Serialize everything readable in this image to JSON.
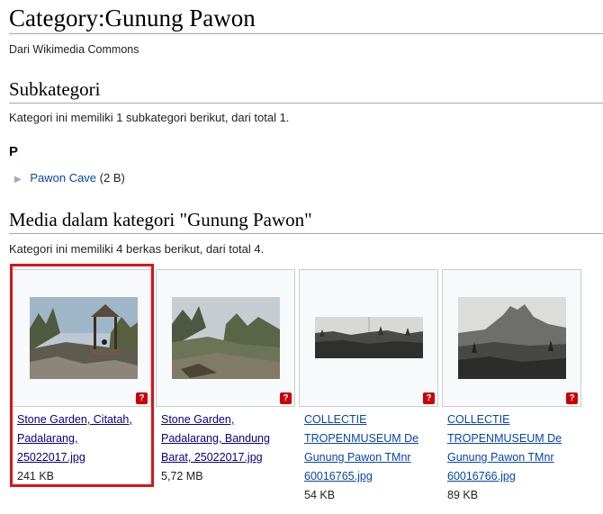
{
  "page": {
    "title": "Category:Gunung Pawon",
    "tagline": "Dari Wikimedia Commons"
  },
  "subcategories": {
    "heading": "Subkategori",
    "summary": "Kategori ini memiliki 1 subkategori berikut, dari total 1.",
    "letter": "P",
    "items": [
      {
        "bullet": "▶",
        "label": "Pawon Cave",
        "count": "(2 B)"
      }
    ]
  },
  "media": {
    "heading": "Media dalam kategori \"Gunung Pawon\"",
    "summary": "Kategori ini memiliki 4 berkas berikut, dari total 4.",
    "badge": "?",
    "files": [
      {
        "name_lines": [
          "Stone Garden, Citatah,",
          "Padalarang,",
          "25022017.jpg"
        ],
        "size": "241 KB",
        "color": "#0b0080"
      },
      {
        "name_lines": [
          "Stone Garden,",
          "Padalarang, Bandung",
          "Barat, 25022017.jpg"
        ],
        "size": "5,72 MB",
        "color": "#0b0080"
      },
      {
        "name_lines": [
          "COLLECTIE",
          "TROPENMUSEUM De",
          "Gunung Pawon TMnr",
          "60016765.jpg"
        ],
        "size": "54 KB",
        "color": "#0645ad"
      },
      {
        "name_lines": [
          "COLLECTIE",
          "TROPENMUSEUM De",
          "Gunung Pawon TMnr",
          "60016766.jpg"
        ],
        "size": "89 KB",
        "color": "#0645ad"
      }
    ]
  },
  "colors": {
    "link": "#0645ad",
    "visited_link": "#0b0080",
    "highlight": "#d9141b",
    "badge": "#cc0000"
  }
}
